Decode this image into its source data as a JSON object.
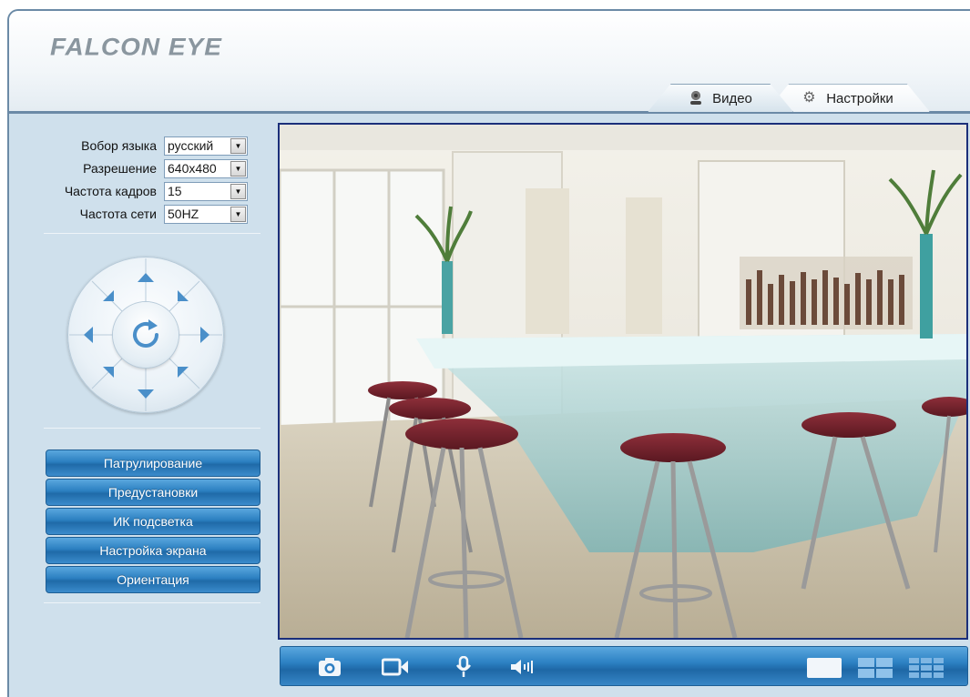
{
  "header": {
    "logo_text": "FALCON EYE"
  },
  "tabs": [
    {
      "label": "Видео",
      "icon": "webcam-icon",
      "active": true
    },
    {
      "label": "Настройки",
      "icon": "gear-icon",
      "active": false
    }
  ],
  "settings": {
    "language": {
      "label": "Вобор языка",
      "value": "русский"
    },
    "resolution": {
      "label": "Разрешение",
      "value": "640x480"
    },
    "frame_rate": {
      "label": "Частота кадров",
      "value": "15"
    },
    "power_frequency": {
      "label": "Частота сети",
      "value": "50HZ"
    }
  },
  "ptz": {
    "buttons": [
      "up",
      "down",
      "left",
      "right",
      "up-left",
      "up-right",
      "down-left",
      "down-right",
      "auto-rotate"
    ]
  },
  "menu": [
    {
      "label": "Патрулирование"
    },
    {
      "label": "Предустановки"
    },
    {
      "label": "ИК подсветка"
    },
    {
      "label": "Настройка экрана"
    },
    {
      "label": "Ориентация"
    }
  ],
  "toolbar": {
    "buttons": [
      "camera-snapshot-icon",
      "record-video-icon",
      "microphone-icon",
      "speaker-icon"
    ],
    "layouts": [
      "single-view-icon",
      "quad-view-icon",
      "nine-view-icon"
    ]
  },
  "colors": {
    "accent_blue": "#2b7fc0",
    "panel_bg": "#cfe0ec",
    "video_border": "#1b2f7a"
  }
}
